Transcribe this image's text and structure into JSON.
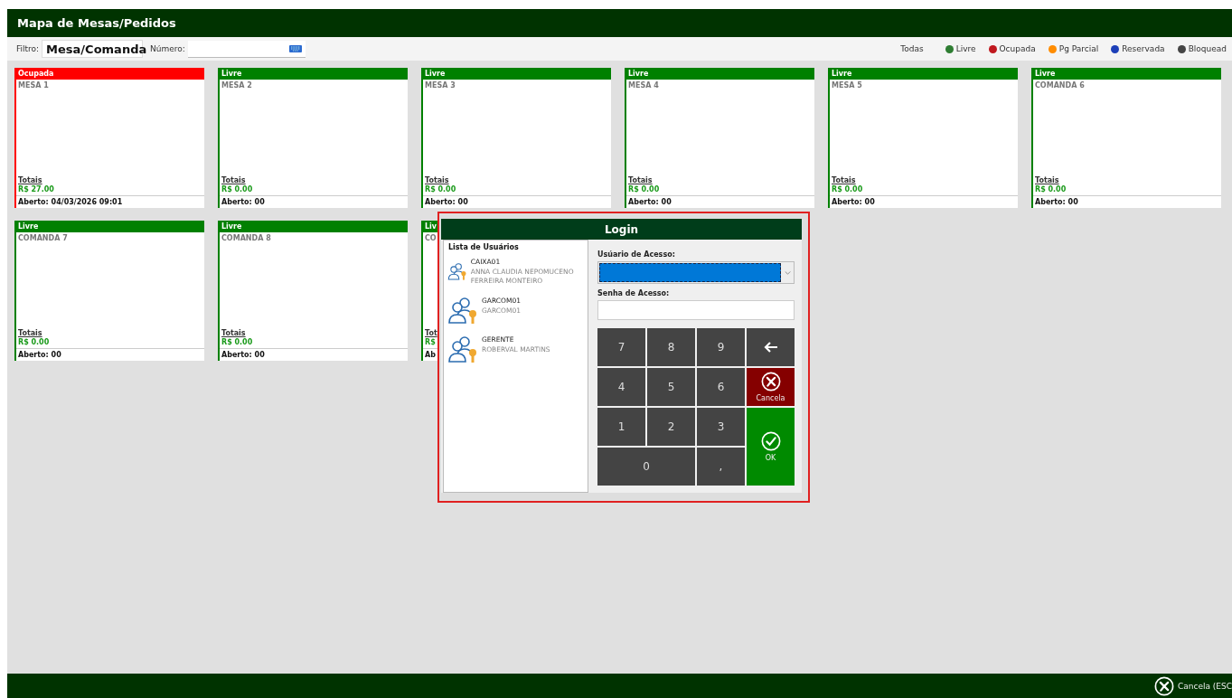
{
  "window": {
    "title": "Mapa de Mesas/Pedidos"
  },
  "toolbar": {
    "filter_label": "Filtro:",
    "filter_value": "Mesa/Comanda",
    "number_label": "Número:"
  },
  "legend": [
    {
      "label": "Todas",
      "kind": "all"
    },
    {
      "label": "Livre",
      "kind": "dot",
      "color": "#2e7d32"
    },
    {
      "label": "Ocupada",
      "kind": "dot",
      "color": "#c0181e"
    },
    {
      "label": "Pg Parcial",
      "kind": "dot",
      "color": "#ff8c00"
    },
    {
      "label": "Reservada",
      "kind": "dot",
      "color": "#1c3fb8"
    },
    {
      "label": "Bloquead",
      "kind": "dot",
      "color": "#444444"
    }
  ],
  "tables": [
    {
      "kind": "occupied",
      "status_label": "Ocupada",
      "name": "MESA 1",
      "totals_label": "Totais",
      "amount": "R$ 27.00",
      "opened": "Aberto: 04/03/2026 09:01"
    },
    {
      "kind": "free",
      "status_label": "Livre",
      "name": "MESA 2",
      "totals_label": "Totais",
      "amount": "R$ 0.00",
      "opened": "Aberto: 00"
    },
    {
      "kind": "free",
      "status_label": "Livre",
      "name": "MESA 3",
      "totals_label": "Totais",
      "amount": "R$ 0.00",
      "opened": "Aberto: 00"
    },
    {
      "kind": "free",
      "status_label": "Livre",
      "name": "MESA 4",
      "totals_label": "Totais",
      "amount": "R$ 0.00",
      "opened": "Aberto: 00"
    },
    {
      "kind": "free",
      "status_label": "Livre",
      "name": "MESA 5",
      "totals_label": "Totais",
      "amount": "R$ 0.00",
      "opened": "Aberto: 00"
    },
    {
      "kind": "free",
      "status_label": "Livre",
      "name": "COMANDA 6",
      "totals_label": "Totais",
      "amount": "R$ 0.00",
      "opened": "Aberto: 00"
    },
    {
      "kind": "free",
      "status_label": "Livre",
      "name": "COMANDA 7",
      "totals_label": "Totais",
      "amount": "R$ 0.00",
      "opened": "Aberto: 00"
    },
    {
      "kind": "free",
      "status_label": "Livre",
      "name": "COMANDA 8",
      "totals_label": "Totais",
      "amount": "R$ 0.00",
      "opened": "Aberto: 00"
    },
    {
      "kind": "free",
      "status_label": "Liv",
      "name": "CO",
      "totals_label": "Tot",
      "amount": "R$",
      "opened": "Ab"
    }
  ],
  "login": {
    "title": "Login",
    "users_title": "Lista de Usuários",
    "users": [
      {
        "login": "CAIXA01",
        "name": "ANNA CLAUDIA NEPOMUCENO FERREIRA MONTEIRO"
      },
      {
        "login": "GARCOM01",
        "name": "GARCOM01"
      },
      {
        "login": "GERENTE",
        "name": "ROBERVAL MARTINS"
      }
    ],
    "user_label": "Usúario de Acesso:",
    "password_label": "Senha de Acesso:",
    "keys": [
      {
        "kind": "digit",
        "label": "7"
      },
      {
        "kind": "digit",
        "label": "8"
      },
      {
        "kind": "digit",
        "label": "9"
      },
      {
        "kind": "backspace"
      },
      {
        "kind": "digit",
        "label": "4"
      },
      {
        "kind": "digit",
        "label": "5"
      },
      {
        "kind": "digit",
        "label": "6"
      },
      {
        "kind": "cancel",
        "label": "Cancela"
      },
      {
        "kind": "digit",
        "label": "1"
      },
      {
        "kind": "digit",
        "label": "2"
      },
      {
        "kind": "digit",
        "label": "3"
      },
      {
        "kind": "ok",
        "label": "OK"
      },
      {
        "kind": "zero",
        "label": "0"
      },
      {
        "kind": "digit",
        "label": ","
      }
    ]
  },
  "footer": {
    "cancel_label": "Cancela (ESC"
  }
}
